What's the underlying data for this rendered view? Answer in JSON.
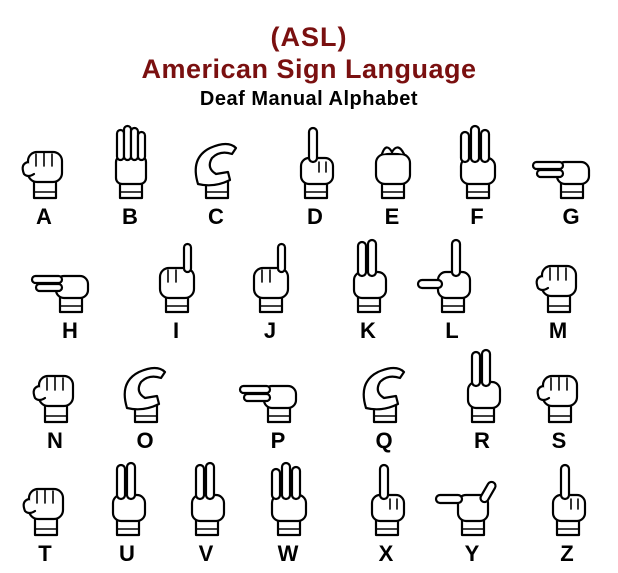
{
  "header": {
    "line1": "(ASL)",
    "line2": "American Sign Language",
    "line3": "Deaf Manual Alphabet"
  },
  "colors": {
    "title": "#7a1010",
    "text": "#000000"
  },
  "signs": [
    {
      "letter": "A",
      "icon": "hand-fist-thumb-side-icon"
    },
    {
      "letter": "B",
      "icon": "hand-flat-fingers-up-icon"
    },
    {
      "letter": "C",
      "icon": "hand-curved-c-icon"
    },
    {
      "letter": "D",
      "icon": "hand-index-up-icon"
    },
    {
      "letter": "E",
      "icon": "hand-curled-fingers-icon"
    },
    {
      "letter": "F",
      "icon": "hand-ok-three-up-icon"
    },
    {
      "letter": "G",
      "icon": "hand-index-point-side-icon"
    },
    {
      "letter": "H",
      "icon": "hand-two-fingers-side-icon"
    },
    {
      "letter": "I",
      "icon": "hand-pinky-up-icon"
    },
    {
      "letter": "J",
      "icon": "hand-pinky-hook-motion-icon"
    },
    {
      "letter": "K",
      "icon": "hand-two-fingers-up-thumb-icon"
    },
    {
      "letter": "L",
      "icon": "hand-l-shape-icon"
    },
    {
      "letter": "M",
      "icon": "hand-thumb-under-three-icon"
    },
    {
      "letter": "N",
      "icon": "hand-thumb-under-two-icon"
    },
    {
      "letter": "O",
      "icon": "hand-o-shape-icon"
    },
    {
      "letter": "P",
      "icon": "hand-pointing-down-side-icon"
    },
    {
      "letter": "Q",
      "icon": "hand-pointing-down-icon"
    },
    {
      "letter": "R",
      "icon": "hand-crossed-fingers-icon"
    },
    {
      "letter": "S",
      "icon": "hand-fist-thumb-front-icon"
    },
    {
      "letter": "T",
      "icon": "hand-thumb-between-icon"
    },
    {
      "letter": "U",
      "icon": "hand-two-fingers-together-icon"
    },
    {
      "letter": "V",
      "icon": "hand-victory-icon"
    },
    {
      "letter": "W",
      "icon": "hand-three-fingers-up-icon"
    },
    {
      "letter": "X",
      "icon": "hand-hooked-index-icon"
    },
    {
      "letter": "Y",
      "icon": "hand-thumb-pinky-out-icon"
    },
    {
      "letter": "Z",
      "icon": "hand-index-z-motion-icon"
    }
  ]
}
